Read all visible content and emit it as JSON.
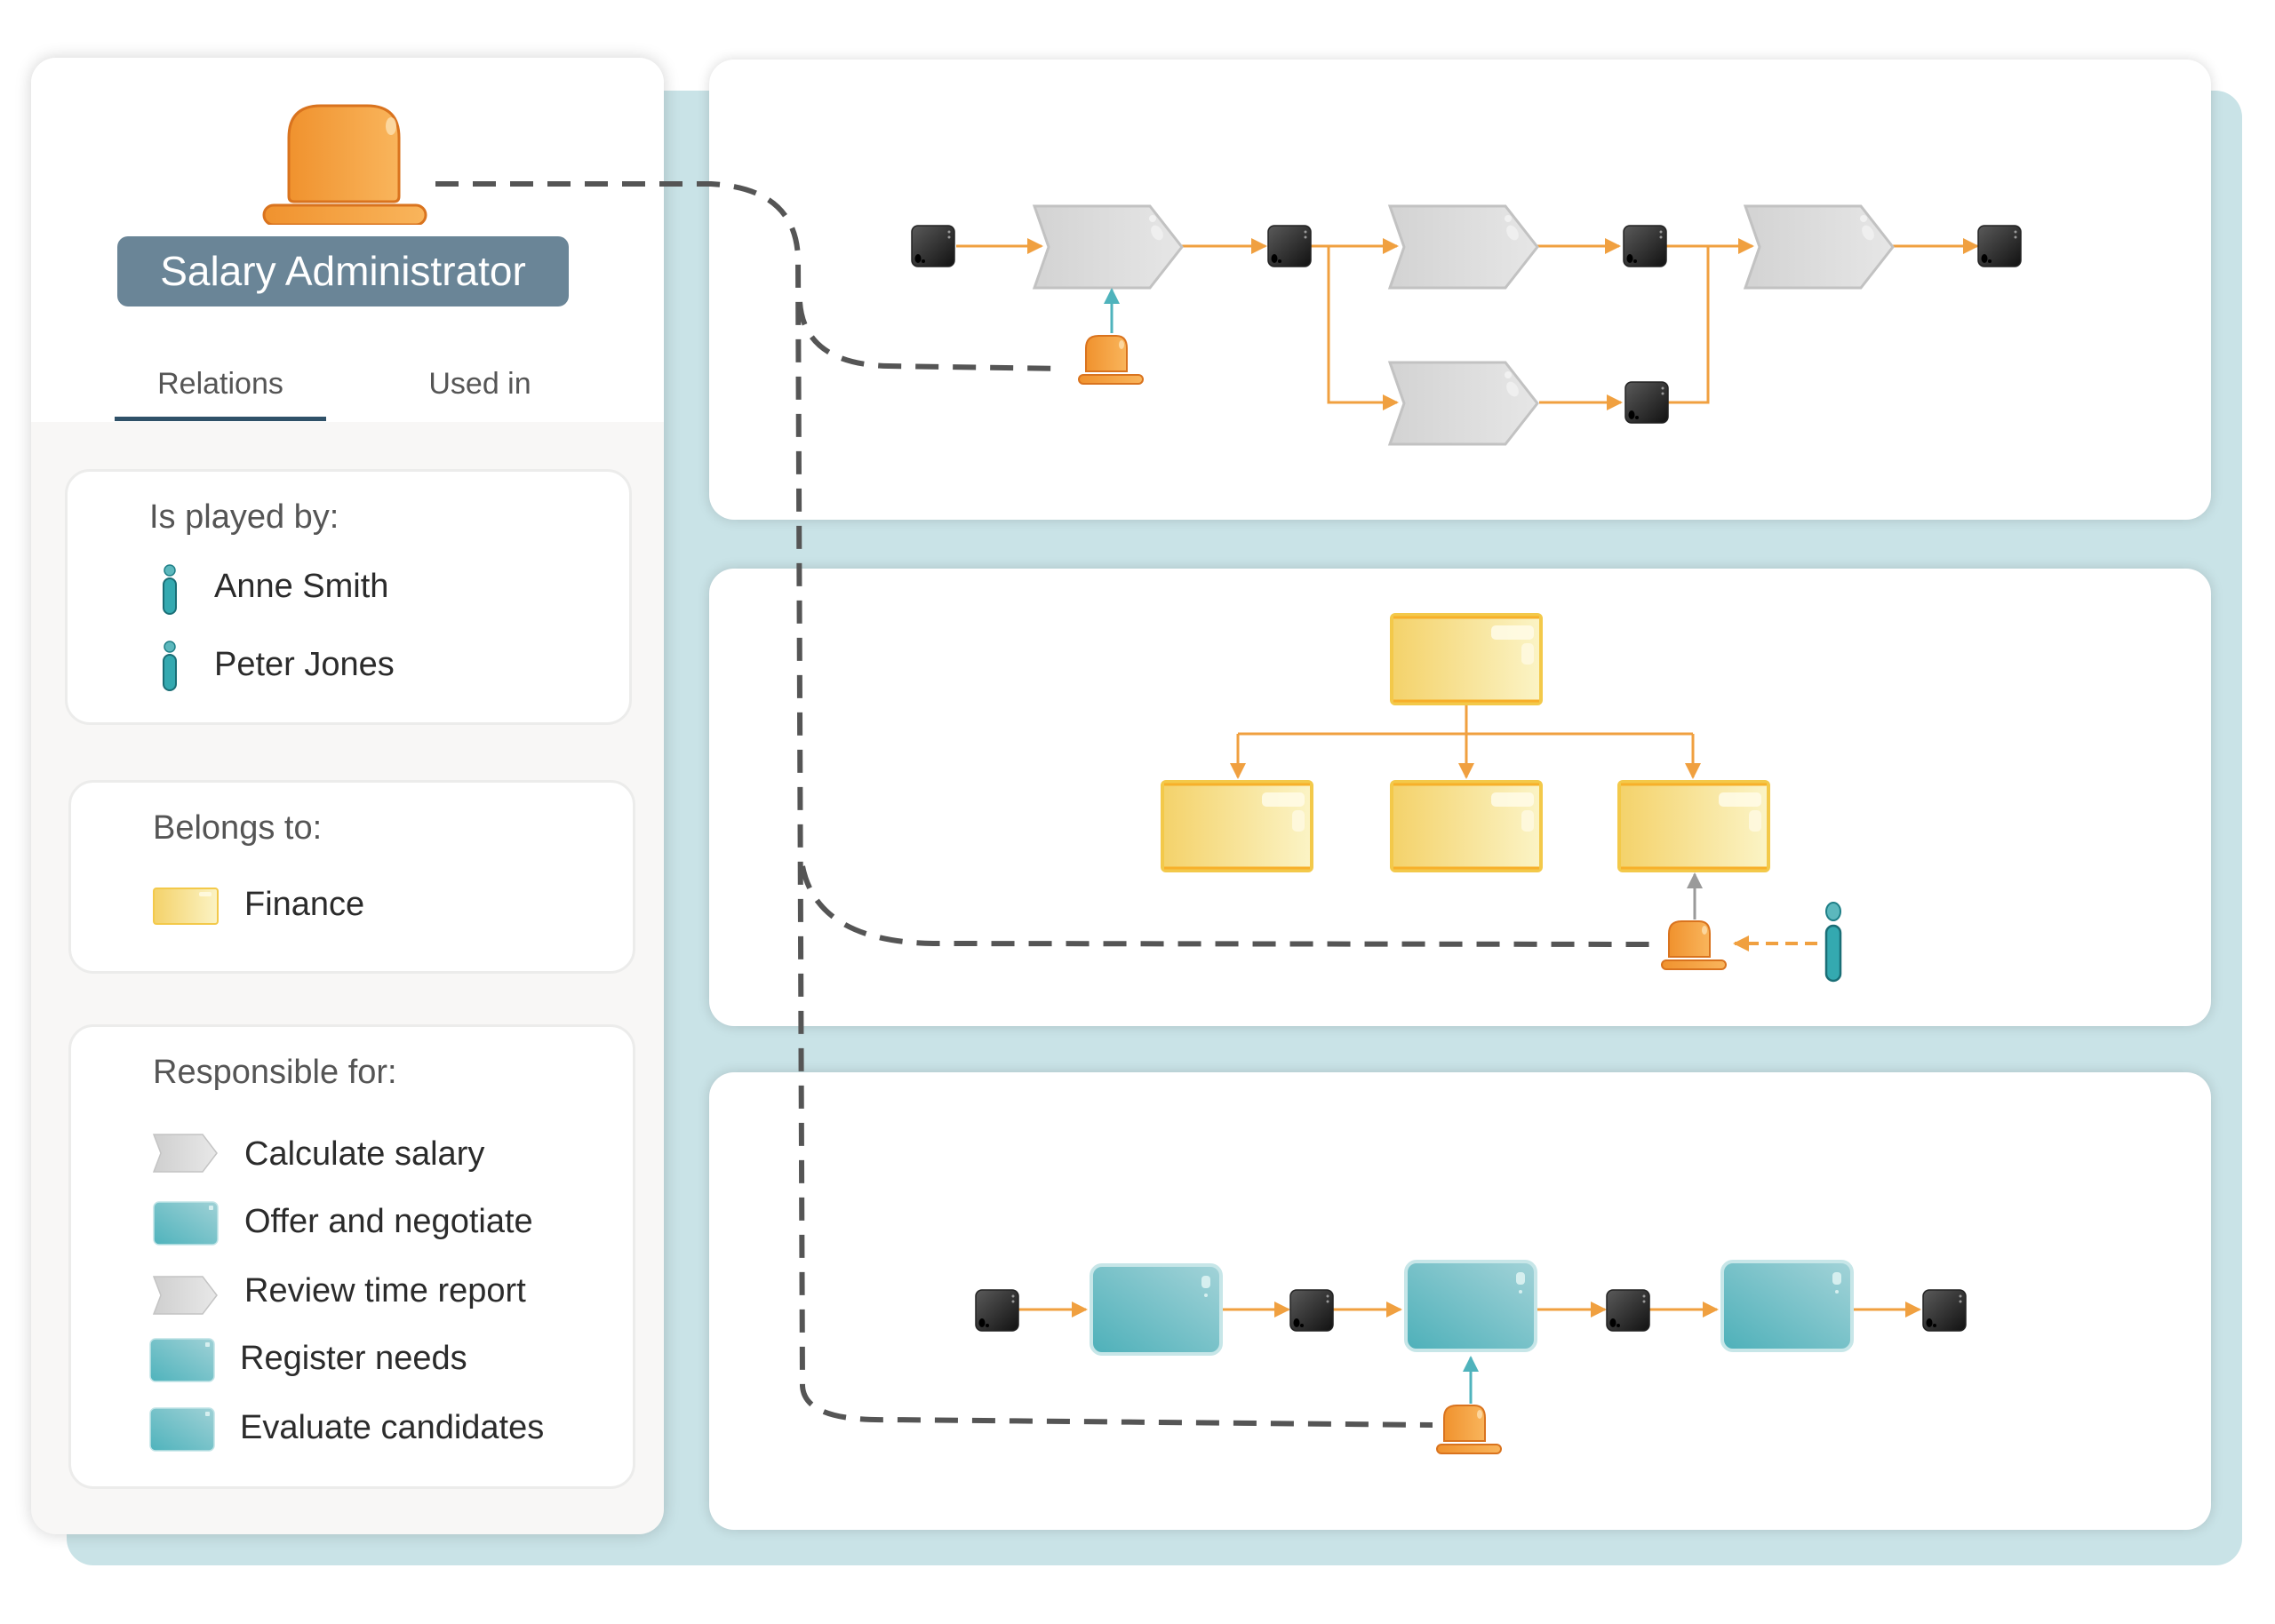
{
  "role": {
    "title": "Salary Administrator",
    "icon": "role-icon"
  },
  "tabs": [
    {
      "label": "Relations",
      "active": true
    },
    {
      "label": "Used in",
      "active": false
    }
  ],
  "sections": {
    "played_by": {
      "title": "Is played by:",
      "items": [
        {
          "label": "Anne Smith",
          "icon": "person-icon"
        },
        {
          "label": "Peter Jones",
          "icon": "person-icon"
        }
      ]
    },
    "belongs_to": {
      "title": "Belongs to:",
      "items": [
        {
          "label": "Finance",
          "icon": "org-unit-icon"
        }
      ]
    },
    "responsible_for": {
      "title": "Responsible for:",
      "items": [
        {
          "label": "Calculate salary",
          "icon": "process-chevron-icon"
        },
        {
          "label": "Offer and negotiate",
          "icon": "activity-box-icon"
        },
        {
          "label": "Review time report",
          "icon": "process-chevron-icon"
        },
        {
          "label": "Register needs",
          "icon": "activity-box-icon"
        },
        {
          "label": "Evaluate candidates",
          "icon": "activity-box-icon"
        }
      ]
    }
  },
  "colors": {
    "title_badge": "#6a8597",
    "tab_underline": "#2f5168",
    "teal_background": "#c9e3e7",
    "flow_arrow": "#f0a040",
    "role_orange": "#f29a3a",
    "person_teal": "#34a9b0",
    "org_yellow": "#f6dc7a",
    "activity_teal": "#6fbec6",
    "event_black": "#2a2a2a",
    "dashed_link": "#555555"
  },
  "diagrams": [
    {
      "name": "process-diagram",
      "type": "process-flow",
      "shapes": "chevron processes with events and a role"
    },
    {
      "name": "org-chart-diagram",
      "type": "organization-chart",
      "shapes": "org units with a role and a person"
    },
    {
      "name": "activity-flow-diagram",
      "type": "activity-flow",
      "shapes": "activities with events and a role"
    }
  ]
}
